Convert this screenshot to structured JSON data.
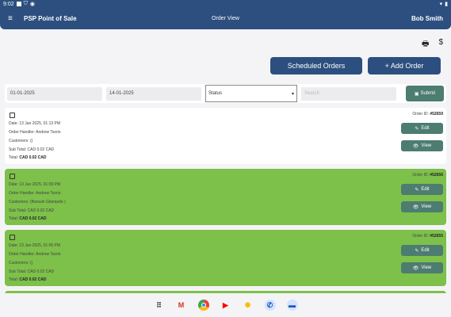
{
  "statusbar": {
    "time": "9:02",
    "icons": [
      "square-icon",
      "shield-icon",
      "circle-icon"
    ],
    "right_icons": [
      "wifi-icon",
      "battery-icon"
    ]
  },
  "appbar": {
    "app_title": "PSP Point of Sale",
    "page_title": "Order View",
    "user": "Bob Smith"
  },
  "toolbar": {
    "scheduled_label": "Scheduled Orders",
    "add_label": "+ Add Order"
  },
  "filters": {
    "date_from": "01-01-2025",
    "date_to": "14-01-2025",
    "status_value": "Status",
    "search_placeholder": "Search",
    "submit_label": "Submit"
  },
  "orders": [
    {
      "date": "Date: 13 Jan 2025, 01:13 PM",
      "handler": "Order Handler: Andrew Tsoris",
      "customers": "Customers: ()",
      "subtotal": "Sub Total: CAD 0.02 CAD",
      "total_label": "Total:",
      "total_value": "CAD 0.02 CAD",
      "oid_label": "Order ID:",
      "oid_value": "#52659",
      "color": "#ffffff"
    },
    {
      "date": "Date: 13 Jan 2025, 01:09 PM",
      "handler": "Order Handler: Andrew Tsoris",
      "customers": "Customers: (Barsuin Gbenjade )",
      "subtotal": "Sub Total: CAD 0.02 CAD",
      "total_label": "Total:",
      "total_value": "CAD 0.02 CAD",
      "oid_label": "Order ID:",
      "oid_value": "#52656",
      "color": "#7dc04a"
    },
    {
      "date": "Date: 13 Jan 2025, 01:05 PM",
      "handler": "Order Handler: Andrew Tsoris",
      "customers": "Customers: ()",
      "subtotal": "Sub Total: CAD 0.02 CAD",
      "total_label": "Total:",
      "total_value": "CAD 0.02 CAD",
      "oid_label": "Order ID:",
      "oid_value": "#52655",
      "color": "#7dc04a"
    }
  ],
  "actions": {
    "edit_label": "Edit",
    "view_label": "View"
  },
  "navbar": {
    "apps": [
      "apps-grid-icon",
      "gmail-icon",
      "chrome-icon",
      "youtube-icon",
      "photos-icon",
      "phone-icon",
      "messages-icon"
    ]
  }
}
